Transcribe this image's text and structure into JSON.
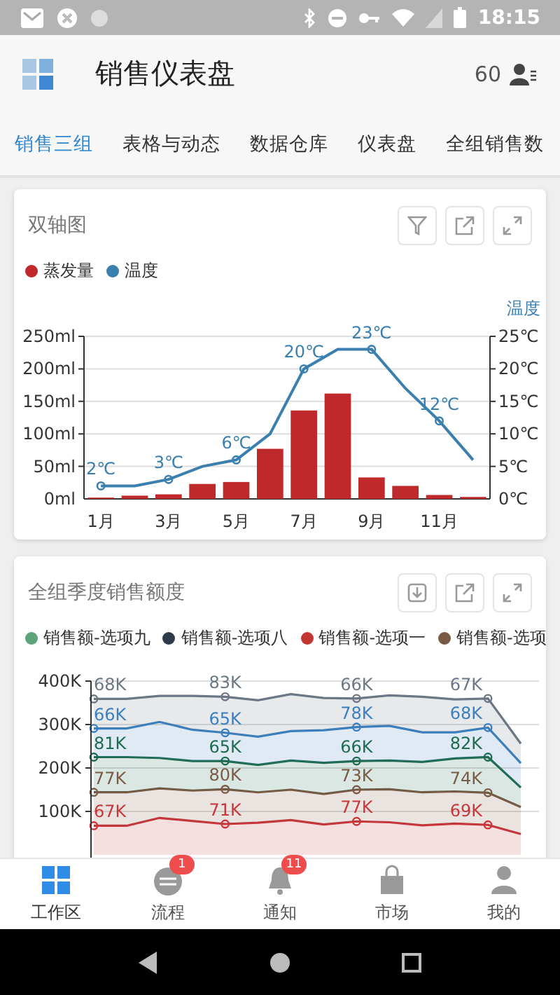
{
  "status_bar": {
    "time": "18:15"
  },
  "header": {
    "title": "销售仪表盘",
    "count": "60"
  },
  "tabs": [
    {
      "label": "销售三组",
      "selected": true
    },
    {
      "label": "表格与动态",
      "selected": false
    },
    {
      "label": "数据仓库",
      "selected": false
    },
    {
      "label": "仪表盘",
      "selected": false
    },
    {
      "label": "全组销售数",
      "selected": false
    }
  ],
  "cards": [
    {
      "kind": "dual_axis",
      "title": "双轴图",
      "chart_data": {
        "type": "bar",
        "grid": true,
        "x": [
          1,
          2,
          3,
          4,
          5,
          6,
          7,
          8,
          9,
          10,
          11,
          12
        ],
        "xlim": [
          0.5,
          12.5
        ],
        "xticks": [
          {
            "value": 1,
            "label": "1月"
          },
          {
            "value": 3,
            "label": "3月"
          },
          {
            "value": 5,
            "label": "5月"
          },
          {
            "value": 7,
            "label": "7月"
          },
          {
            "value": 9,
            "label": "9月"
          },
          {
            "value": 11,
            "label": "11月"
          }
        ],
        "ylim": [
          0,
          250
        ],
        "yticks": [
          {
            "value": 0,
            "label": "0ml"
          },
          {
            "value": 50,
            "label": "50ml"
          },
          {
            "value": 100,
            "label": "100ml"
          },
          {
            "value": 150,
            "label": "150ml"
          },
          {
            "value": 200,
            "label": "200ml"
          },
          {
            "value": 250,
            "label": "250ml"
          }
        ],
        "y2label": "温度",
        "y2lim": [
          0,
          25
        ],
        "y2ticks": [
          {
            "value": 0,
            "label": "0℃"
          },
          {
            "value": 5,
            "label": "5℃"
          },
          {
            "value": 10,
            "label": "10℃"
          },
          {
            "value": 15,
            "label": "15℃"
          },
          {
            "value": 20,
            "label": "20℃"
          },
          {
            "value": 25,
            "label": "25℃"
          }
        ],
        "series": [
          {
            "name": "蒸发量",
            "type": "bar",
            "color": "#c0292b",
            "values": [
              2,
              5,
              7,
              23,
              26,
              77,
              136,
              162,
              33,
              20,
              6,
              3
            ]
          },
          {
            "name": "温度",
            "type": "line",
            "axis": "y2",
            "color": "#3a7fae",
            "values": [
              2,
              2,
              3,
              5,
              6,
              10,
              20,
              23,
              23,
              17,
              12,
              6
            ],
            "value_labels": [
              "2℃",
              null,
              "3℃",
              null,
              "6℃",
              null,
              "20℃",
              null,
              "23℃",
              null,
              "12℃",
              null
            ]
          }
        ]
      }
    },
    {
      "kind": "stacked_area",
      "title": "全组季度销售额度",
      "legend": [
        {
          "label": "销售额-选项九",
          "color": "#5ba47a"
        },
        {
          "label": "销售额-选项八",
          "color": "#2d3a4a"
        },
        {
          "label": "销售额-选项一",
          "color": "#c23531"
        },
        {
          "label": "销售额-选项",
          "color": "#7b5a45"
        }
      ],
      "chart_data": {
        "type": "area",
        "stacked": true,
        "grid": true,
        "categories": [
          null,
          null,
          null,
          null,
          null,
          null,
          null,
          null,
          null,
          null,
          null,
          null,
          null,
          null
        ],
        "ylim": [
          0,
          400
        ],
        "yticks": [
          {
            "value": 100,
            "label": "100K"
          },
          {
            "value": 200,
            "label": "200K"
          },
          {
            "value": 300,
            "label": "300K"
          },
          {
            "value": 400,
            "label": "400K"
          }
        ],
        "series": [
          {
            "color": "#c9353a",
            "values": [
              67,
              67,
              85,
              78,
              71,
              74,
              80,
              70,
              77,
              75,
              68,
              72,
              69,
              48
            ],
            "value_labels": [
              "67K",
              null,
              null,
              null,
              "71K",
              null,
              null,
              null,
              "77K",
              null,
              null,
              null,
              "69K",
              null
            ]
          },
          {
            "color": "#7b5a45",
            "values": [
              77,
              77,
              68,
              70,
              80,
              70,
              70,
              70,
              73,
              76,
              76,
              74,
              74,
              62
            ],
            "value_labels": [
              "77K",
              null,
              null,
              null,
              "80K",
              null,
              null,
              null,
              "73K",
              null,
              null,
              null,
              "74K",
              null
            ]
          },
          {
            "color": "#1f6b4f",
            "values": [
              81,
              81,
              70,
              68,
              65,
              63,
              67,
              72,
              66,
              66,
              70,
              76,
              82,
              45
            ],
            "value_labels": [
              "81K",
              null,
              null,
              null,
              "65K",
              null,
              null,
              null,
              "66K",
              null,
              null,
              null,
              "82K",
              null
            ]
          },
          {
            "color": "#3a7fbf",
            "values": [
              66,
              66,
              83,
              72,
              65,
              65,
              68,
              75,
              78,
              80,
              68,
              60,
              68,
              56
            ],
            "value_labels": [
              "66K",
              null,
              null,
              null,
              "65K",
              null,
              null,
              null,
              "78K",
              null,
              null,
              null,
              "68K",
              null
            ]
          },
          {
            "color": "#6b7785",
            "values": [
              68,
              68,
              60,
              78,
              83,
              84,
              85,
              74,
              66,
              70,
              82,
              76,
              67,
              45
            ],
            "value_labels": [
              "68K",
              null,
              null,
              null,
              "83K",
              null,
              null,
              null,
              "66K",
              null,
              null,
              null,
              "67K",
              null
            ]
          }
        ]
      }
    }
  ],
  "bottom_nav": [
    {
      "label": "工作区",
      "selected": true
    },
    {
      "label": "流程",
      "selected": false,
      "badge": "1"
    },
    {
      "label": "通知",
      "selected": false,
      "badge": "11"
    },
    {
      "label": "市场",
      "selected": false
    },
    {
      "label": "我的",
      "selected": false
    }
  ]
}
